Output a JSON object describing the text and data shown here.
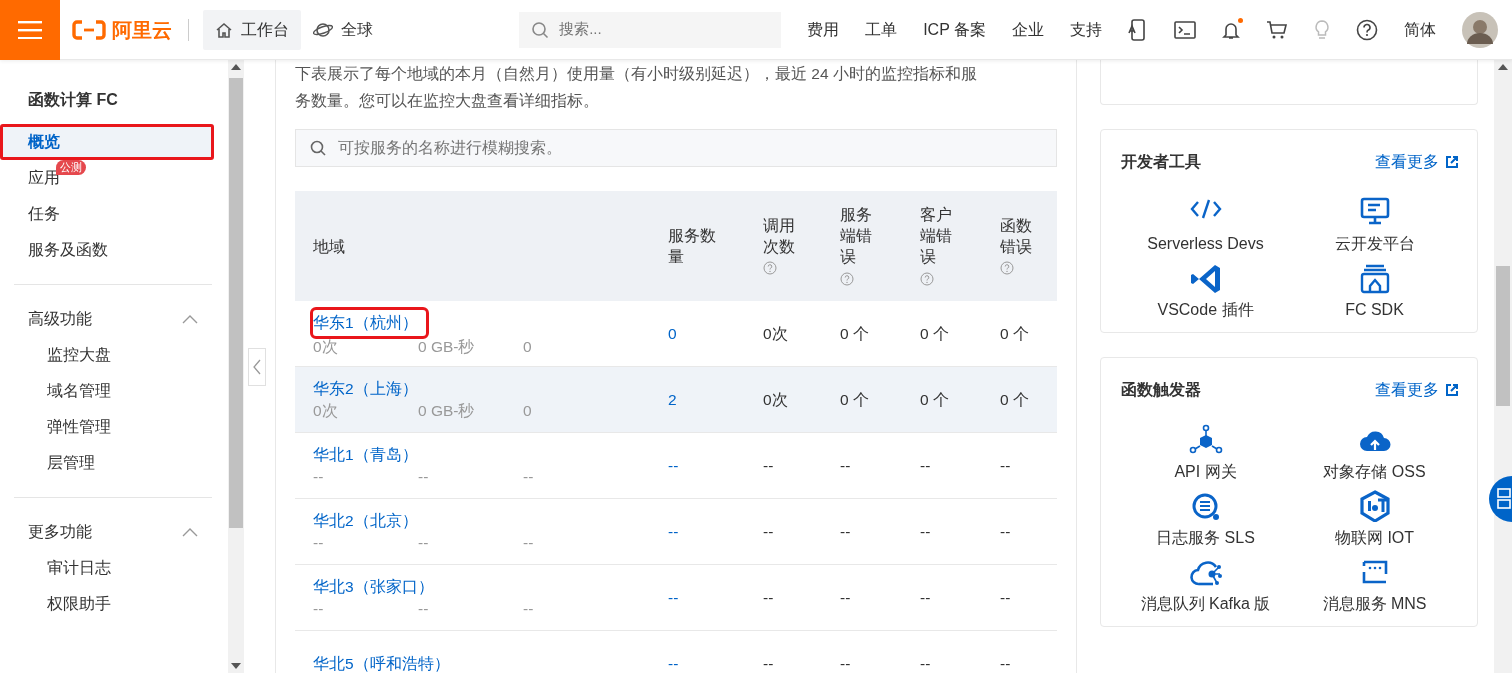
{
  "header": {
    "logo_text": "阿里云",
    "nav": [
      {
        "label": "工作台",
        "selected": true
      },
      {
        "label": "全球",
        "selected": false
      }
    ],
    "search": {
      "placeholder": "搜索..."
    },
    "links": [
      "费用",
      "工单",
      "ICP 备案",
      "企业",
      "支持"
    ],
    "notification": true,
    "language": "简体"
  },
  "sidebar": {
    "title": "函数计算 FC",
    "items": [
      {
        "label": "概览",
        "selected": true,
        "annotated": true
      },
      {
        "label": "应用",
        "selected": false,
        "annotated": false,
        "badge": "公测"
      },
      {
        "label": "任务",
        "selected": false,
        "annotated": false
      },
      {
        "label": "服务及函数",
        "selected": false,
        "annotated": false
      }
    ],
    "groups": [
      {
        "title": "高级功能",
        "expanded": true,
        "items": [
          "监控大盘",
          "域名管理",
          "弹性管理",
          "层管理"
        ]
      },
      {
        "title": "更多功能",
        "expanded": true,
        "items": [
          "审计日志",
          "权限助手"
        ]
      }
    ]
  },
  "overview": {
    "intro": "下表展示了每个地域的本月（自然月）使用量（有小时级别延迟），最近 24 小时的监控指标和服务数量。您可以在",
    "intro_link": "监控大盘",
    "intro_end": "查看详细指标。",
    "search": {
      "placeholder": "可按服务的名称进行模糊搜索。"
    },
    "table": {
      "columns": [
        {
          "label": "地域",
          "help": false
        },
        {
          "label": "服务数量",
          "help": false
        },
        {
          "label": "调用次数",
          "help": true
        },
        {
          "label": "服务端错误",
          "help": true
        },
        {
          "label": "客户端错误",
          "help": true
        },
        {
          "label": "函数错误",
          "help": true
        }
      ],
      "rows": [
        {
          "region": "华东1（杭州）",
          "annotated": true,
          "hovered": false,
          "usage": [
            "0次",
            "0 GB-秒",
            "0"
          ],
          "services": "0",
          "calls": "0次",
          "server_errors": "0 个",
          "client_errors": "0 个",
          "function_errors": "0 个"
        },
        {
          "region": "华东2（上海）",
          "annotated": false,
          "hovered": true,
          "usage": [
            "0次",
            "0 GB-秒",
            "0"
          ],
          "services": "2",
          "calls": "0次",
          "server_errors": "0 个",
          "client_errors": "0 个",
          "function_errors": "0 个"
        },
        {
          "region": "华北1（青岛）",
          "annotated": false,
          "hovered": false,
          "usage": [
            "--",
            "--",
            "--"
          ],
          "services": "--",
          "calls": "--",
          "server_errors": "--",
          "client_errors": "--",
          "function_errors": "--"
        },
        {
          "region": "华北2（北京）",
          "annotated": false,
          "hovered": false,
          "usage": [
            "--",
            "--",
            "--"
          ],
          "services": "--",
          "calls": "--",
          "server_errors": "--",
          "client_errors": "--",
          "function_errors": "--"
        },
        {
          "region": "华北3（张家口）",
          "annotated": false,
          "hovered": false,
          "usage": [
            "--",
            "--",
            "--"
          ],
          "services": "--",
          "calls": "--",
          "server_errors": "--",
          "client_errors": "--",
          "function_errors": "--"
        },
        {
          "region": "华北5（呼和浩特）",
          "annotated": false,
          "hovered": false,
          "services": "--",
          "calls": "--",
          "server_errors": "--",
          "client_errors": "--",
          "function_errors": "--"
        }
      ]
    }
  },
  "panels": [
    {
      "title": "开发者工具",
      "more": "查看更多",
      "items": [
        "Serverless Devs",
        "云开发平台",
        "VSCode 插件",
        "FC SDK"
      ]
    },
    {
      "title": "函数触发器",
      "more": "查看更多",
      "items": [
        "API 网关",
        "对象存储 OSS",
        "日志服务 SLS",
        "物联网 IOT",
        "消息队列 Kafka 版",
        "消息服务 MNS"
      ]
    }
  ]
}
